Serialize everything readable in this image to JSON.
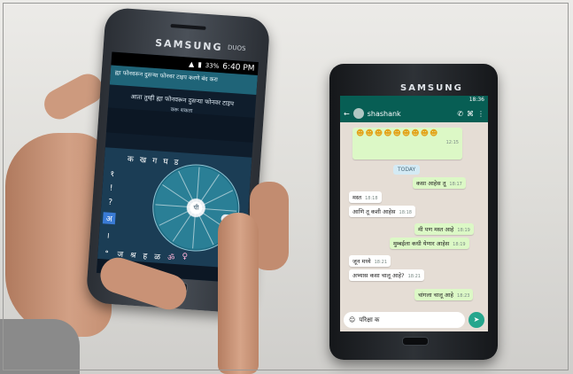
{
  "left_phone": {
    "brand": "SAMSUNG",
    "model_badge": "DUOS",
    "status_bar": {
      "battery": "33%",
      "time": "6:40 PM"
    },
    "notification": "ह्या फोनवरून दुसऱ्या फोनवर टाइप करणे बंद करा",
    "prompt_line1": "आता तुम्ही ह्या फोनवरून दुसऱ्या फोनवर टाइप",
    "prompt_line2": "करू शकता",
    "keyboard": {
      "top_row": [
        "क",
        "ख",
        "ग",
        "घ",
        "ड"
      ],
      "side_keys": [
        "१",
        "!",
        "?",
        "अ",
        "।",
        "॰"
      ],
      "wheel_center": "पी",
      "bottom_row": [
        "ज",
        "श्र",
        "ह",
        "ळ",
        "ॐ",
        "♀"
      ],
      "footer_lang": "En",
      "delete_glyph": "⌫"
    }
  },
  "right_phone": {
    "brand": "SAMSUNG",
    "status_time": "18:36",
    "contact_name": "shashank",
    "emoji_time": "12:15",
    "date_label": "TODAY",
    "messages": [
      {
        "text": "कसा आहेस तू",
        "time": "18:17",
        "dir": "out"
      },
      {
        "text": "मस्त",
        "time": "18:18",
        "dir": "in"
      },
      {
        "text": "आणि तू कशी आहेस",
        "time": "18:18",
        "dir": "in"
      },
      {
        "text": "मी पण मस्त आहे",
        "time": "18:19",
        "dir": "out"
      },
      {
        "text": "मुम्बईला कधी येणार आहेस",
        "time": "18:19",
        "dir": "out"
      },
      {
        "text": "जून मध्ये",
        "time": "18:21",
        "dir": "in"
      },
      {
        "text": "अभ्यास कसा चालू आहे?",
        "time": "18:21",
        "dir": "in"
      },
      {
        "text": "चांगला चालू आहे",
        "time": "18:23",
        "dir": "out"
      }
    ],
    "input_text": "परिक्षा क"
  }
}
